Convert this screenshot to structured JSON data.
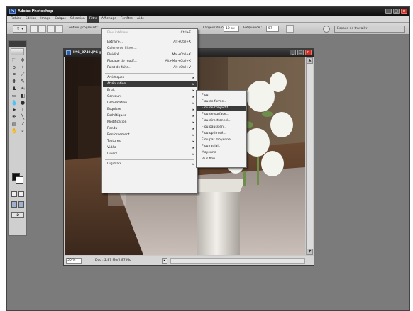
{
  "app": {
    "title": "Adobe Photoshop",
    "logo_text": "Ps"
  },
  "menubar": [
    "Fichier",
    "Edition",
    "Image",
    "Calque",
    "Sélection",
    "Filtre",
    "Affichage",
    "Fenêtre",
    "Aide"
  ],
  "menubar_active": "Filtre",
  "options_bar": {
    "tool_preset": "↕ ▾",
    "contour_label": "Contour progressif :",
    "contour_value": "",
    "lissage_label": "Lissage",
    "width_label": "Largeur de contour :",
    "width_value": "10 px",
    "frequency_label": "Fréquence :",
    "frequency_value": "57",
    "workspace_label": "Espace de travail ▾"
  },
  "filter_menu": {
    "items": [
      {
        "label": "Flou intérieur",
        "shortcut": "Ctrl+F",
        "disabled": true
      },
      {
        "label": "Extraire...",
        "shortcut": "Alt+Ctrl+X"
      },
      {
        "label": "Galerie de filtres..."
      },
      {
        "label": "Fluidité...",
        "shortcut": "Maj+Ctrl+X"
      },
      {
        "label": "Placage de motif...",
        "shortcut": "Alt+Maj+Ctrl+X"
      },
      {
        "label": "Point de fuite...",
        "shortcut": "Alt+Ctrl+V"
      },
      {
        "label": "Artistiques",
        "submenu": true
      },
      {
        "label": "Atténuation",
        "submenu": true,
        "highlighted": true
      },
      {
        "label": "Bruit",
        "submenu": true
      },
      {
        "label": "Contours",
        "submenu": true
      },
      {
        "label": "Déformation",
        "submenu": true
      },
      {
        "label": "Esquisse",
        "submenu": true
      },
      {
        "label": "Esthétiques",
        "submenu": true
      },
      {
        "label": "Modification",
        "submenu": true
      },
      {
        "label": "Rendu",
        "submenu": true
      },
      {
        "label": "Renforcement",
        "submenu": true
      },
      {
        "label": "Textures",
        "submenu": true
      },
      {
        "label": "Vidéo",
        "submenu": true
      },
      {
        "label": "Divers",
        "submenu": true
      },
      {
        "label": "Digimarc",
        "submenu": true
      }
    ]
  },
  "blur_menu": {
    "items": [
      {
        "label": "Flou"
      },
      {
        "label": "Flou de forme..."
      },
      {
        "label": "Flou de l'objectif...",
        "highlighted": true
      },
      {
        "label": "Flou de surface..."
      },
      {
        "label": "Flou directionnel..."
      },
      {
        "label": "Flou gaussien..."
      },
      {
        "label": "Flou optimisé..."
      },
      {
        "label": "Flou par moyenne..."
      },
      {
        "label": "Flou radial..."
      },
      {
        "label": "Moyenne"
      },
      {
        "label": "Plus flou"
      }
    ]
  },
  "document": {
    "title": "IMG_0749.JPG @ 50% (RVB/8)",
    "zoom": "50 %",
    "doc_size": "Doc : 2,87 Mo/2,87 Mo"
  },
  "colors": {
    "app_background": "#7b7b7b",
    "menu_highlight": "#3a3a3a",
    "close_button": "#c8322a"
  }
}
